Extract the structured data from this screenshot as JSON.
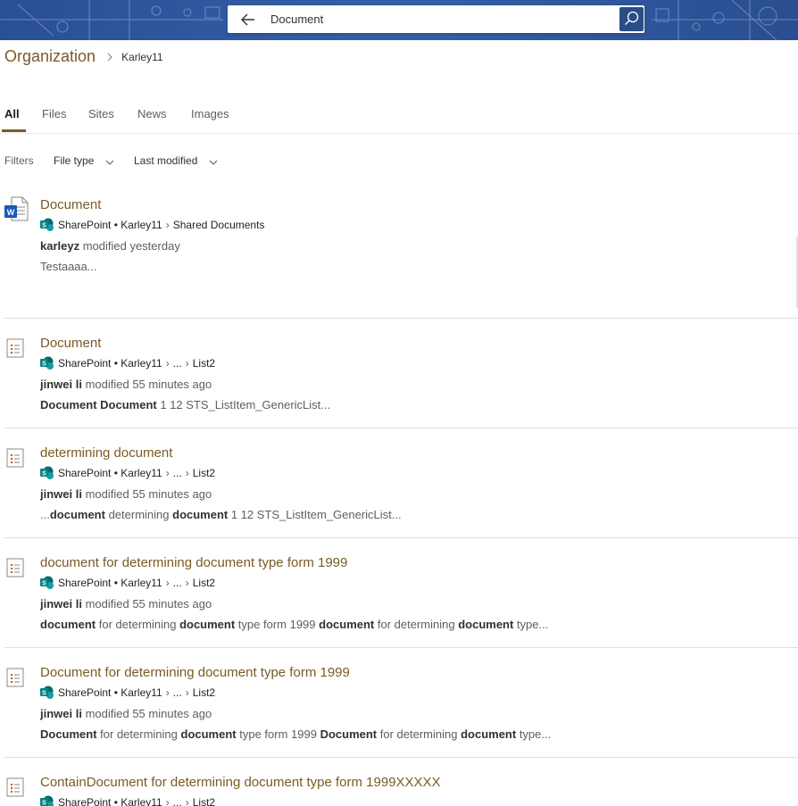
{
  "search": {
    "query": "Document"
  },
  "breadcrumb": {
    "root": "Organization",
    "site": "Karley11"
  },
  "tabs": [
    {
      "label": "All",
      "active": true
    },
    {
      "label": "Files"
    },
    {
      "label": "Sites"
    },
    {
      "label": "News"
    },
    {
      "label": "Images"
    }
  ],
  "filters": {
    "label": "Filters",
    "file_type": "File type",
    "last_modified": "Last modified"
  },
  "results": [
    {
      "icon": "word-doc-icon",
      "title": "Document",
      "path": {
        "app": "SharePoint • Karley11",
        "segments": [
          "Shared Documents"
        ]
      },
      "modified_by": "karleyz",
      "modified": " modified yesterday",
      "snippet": [
        {
          "t": "Testaaaa..."
        }
      ]
    },
    {
      "icon": "list-item-icon",
      "title": "Document",
      "path": {
        "app": "SharePoint • Karley11",
        "segments": [
          "...",
          "List2"
        ]
      },
      "modified_by": "jinwei li",
      "modified": " modified 55 minutes ago",
      "snippet": [
        {
          "t": "Document Document",
          "b": true
        },
        {
          "t": " 1 12 STS_ListItem_GenericList..."
        }
      ]
    },
    {
      "icon": "list-item-icon",
      "title": "determining document",
      "path": {
        "app": "SharePoint • Karley11",
        "segments": [
          "...",
          "List2"
        ]
      },
      "modified_by": "jinwei li",
      "modified": " modified 55 minutes ago",
      "snippet": [
        {
          "t": "..."
        },
        {
          "t": "document",
          "b": true
        },
        {
          "t": " determining "
        },
        {
          "t": "document",
          "b": true
        },
        {
          "t": " 1 12 STS_ListItem_GenericList..."
        }
      ]
    },
    {
      "icon": "list-item-icon",
      "title": "document for determining document type form 1999",
      "path": {
        "app": "SharePoint • Karley11",
        "segments": [
          "...",
          "List2"
        ]
      },
      "modified_by": "jinwei li",
      "modified": " modified 55 minutes ago",
      "snippet": [
        {
          "t": "document",
          "b": true
        },
        {
          "t": " for determining "
        },
        {
          "t": "document",
          "b": true
        },
        {
          "t": " type form 1999 "
        },
        {
          "t": "document",
          "b": true
        },
        {
          "t": " for determining "
        },
        {
          "t": "document",
          "b": true
        },
        {
          "t": " type..."
        }
      ]
    },
    {
      "icon": "list-item-icon",
      "title": "Document for determining document type form 1999",
      "path": {
        "app": "SharePoint • Karley11",
        "segments": [
          "...",
          "List2"
        ]
      },
      "modified_by": "jinwei li",
      "modified": " modified 55 minutes ago",
      "snippet": [
        {
          "t": "Document",
          "b": true
        },
        {
          "t": " for determining "
        },
        {
          "t": "document",
          "b": true
        },
        {
          "t": " type form 1999 "
        },
        {
          "t": "Document",
          "b": true
        },
        {
          "t": " for determining "
        },
        {
          "t": "document",
          "b": true
        },
        {
          "t": " type..."
        }
      ]
    },
    {
      "icon": "list-item-icon",
      "title": "ContainDocument for determining document type form 1999XXXXX",
      "path": {
        "app": "SharePoint • Karley11",
        "segments": [
          "...",
          "List2"
        ]
      },
      "modified_by": "",
      "modified": "",
      "snippet": []
    }
  ],
  "colors": {
    "accent": "#7a5b24",
    "banner": "#2b4f93",
    "sharepoint": "#038387"
  }
}
